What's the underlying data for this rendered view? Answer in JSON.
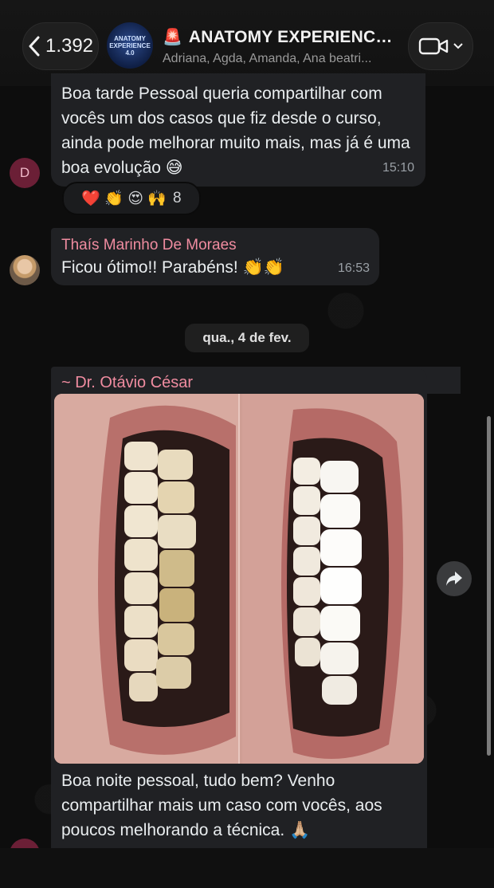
{
  "header": {
    "back_count": "1.392",
    "group_avatar_text": "ANATOMY EXPERIENCE 4.0",
    "title": "ANATOMY EXPERIENCE...",
    "title_emoji": "🚨",
    "subtitle": "Adriana, Agda, Amanda, Ana beatri..."
  },
  "messages": [
    {
      "avatar_letter": "D",
      "text": "Boa tarde Pessoal queria compartilhar com vocês um dos casos que fiz desde o curso, ainda pode melhorar muito mais, mas já é uma boa evolução 😅",
      "time": "15:10",
      "reactions": {
        "emojis": "❤️ 👏 😍 🙌",
        "count": "8"
      }
    },
    {
      "sender": "Thaís Marinho De Moraes",
      "text": "Ficou ótimo!! Parabéns! 👏👏",
      "time": "16:53"
    },
    {
      "sender": "~ Dr. Otávio César",
      "caption": "Boa noite pessoal, tudo bem? Venho compartilhar mais um caso com vocês, aos poucos melhorando a técnica. 🙏🏼"
    }
  ],
  "date_separator": "qua., 4 de fev.",
  "colors": {
    "bubble": "#202124",
    "sender_name": "#f08ca0",
    "background": "#0d0d0d"
  },
  "icons": {
    "back": "chevron-left-icon",
    "video": "video-camera-icon",
    "forward": "forward-icon"
  }
}
